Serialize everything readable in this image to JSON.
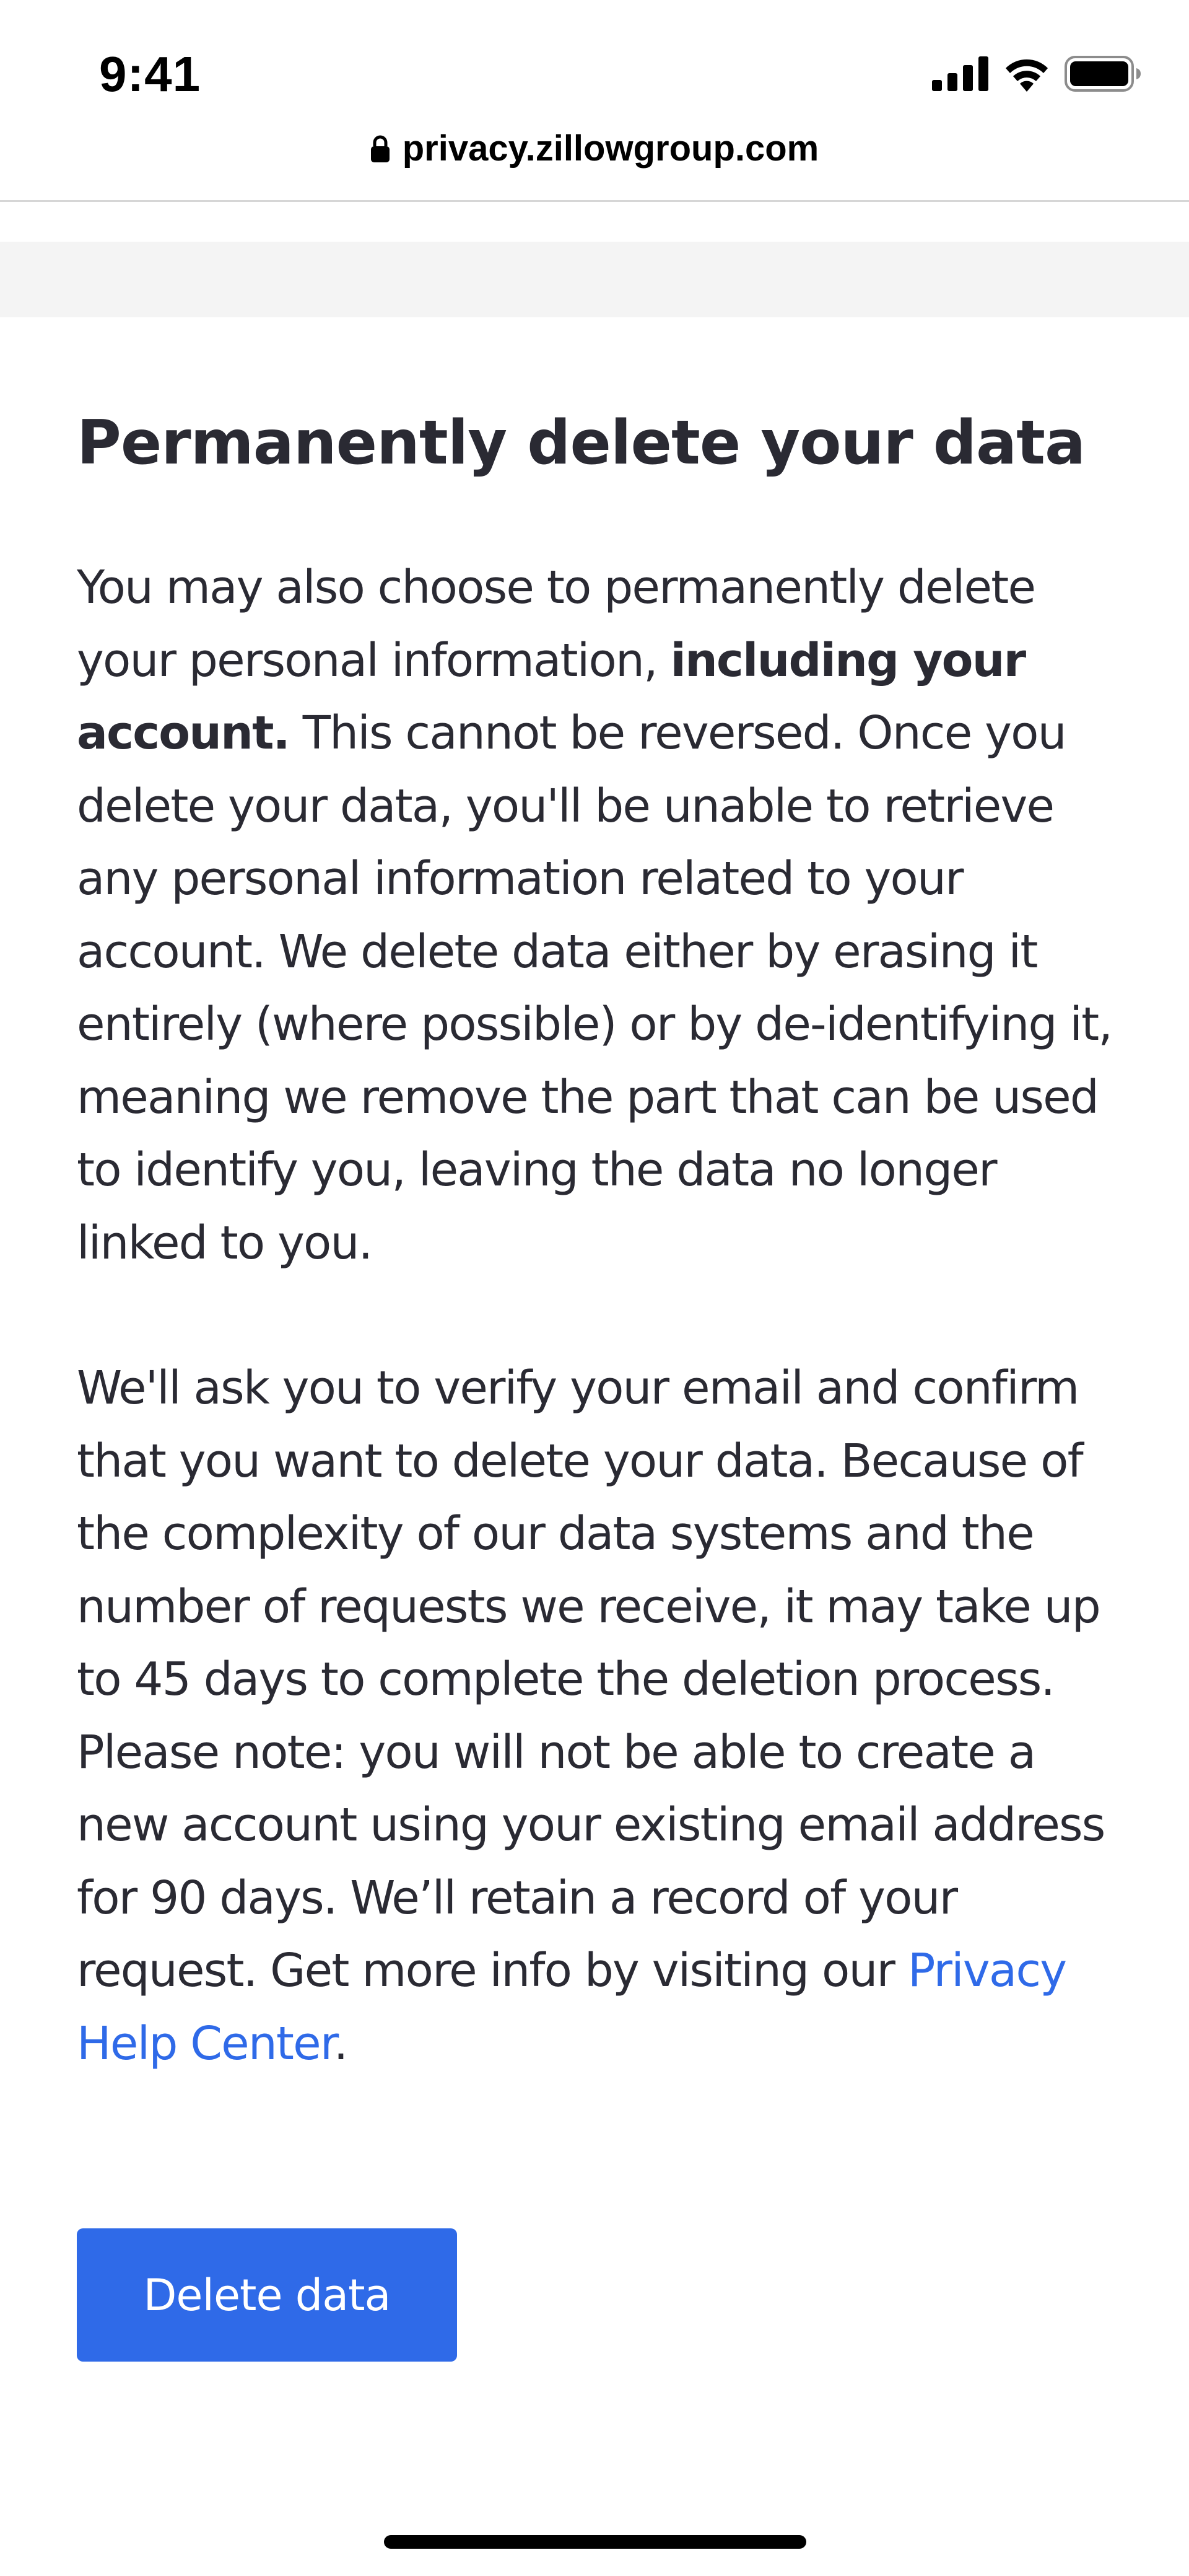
{
  "status_bar": {
    "time": "9:41",
    "icons": [
      "cellular-signal-icon",
      "wifi-icon",
      "battery-icon"
    ]
  },
  "browser": {
    "url": "privacy.zillowgroup.com",
    "url_icon": "lock-icon"
  },
  "page": {
    "title": "Permanently delete your data",
    "paragraph1": {
      "intro": "You may also choose to permanently delete your personal information, ",
      "bold": "including your account.",
      "rest": " This cannot be reversed. Once you delete your data, you'll be unable to retrieve any personal information related to your account. We delete data either by erasing it entirely (where possible) or by de-identifying it, meaning we remove the part that can be used to identify you, leaving the data no longer linked to you."
    },
    "paragraph2": {
      "text": "We'll ask you to verify your email and confirm that you want to delete your data. Because of the complexity of our data systems and the number of requests we receive, it may take up to 45 days to complete the deletion process. Please note: you will not be able to create a new account using your existing email address for 90 days. We’ll retain a record of your request. Get more info by visiting our ",
      "link_text": "Privacy Help Center",
      "end": "."
    },
    "delete_button_label": "Delete data"
  },
  "colors": {
    "accent": "#2f6ae8",
    "text": "#2a2a33",
    "band": "#f4f4f4"
  }
}
